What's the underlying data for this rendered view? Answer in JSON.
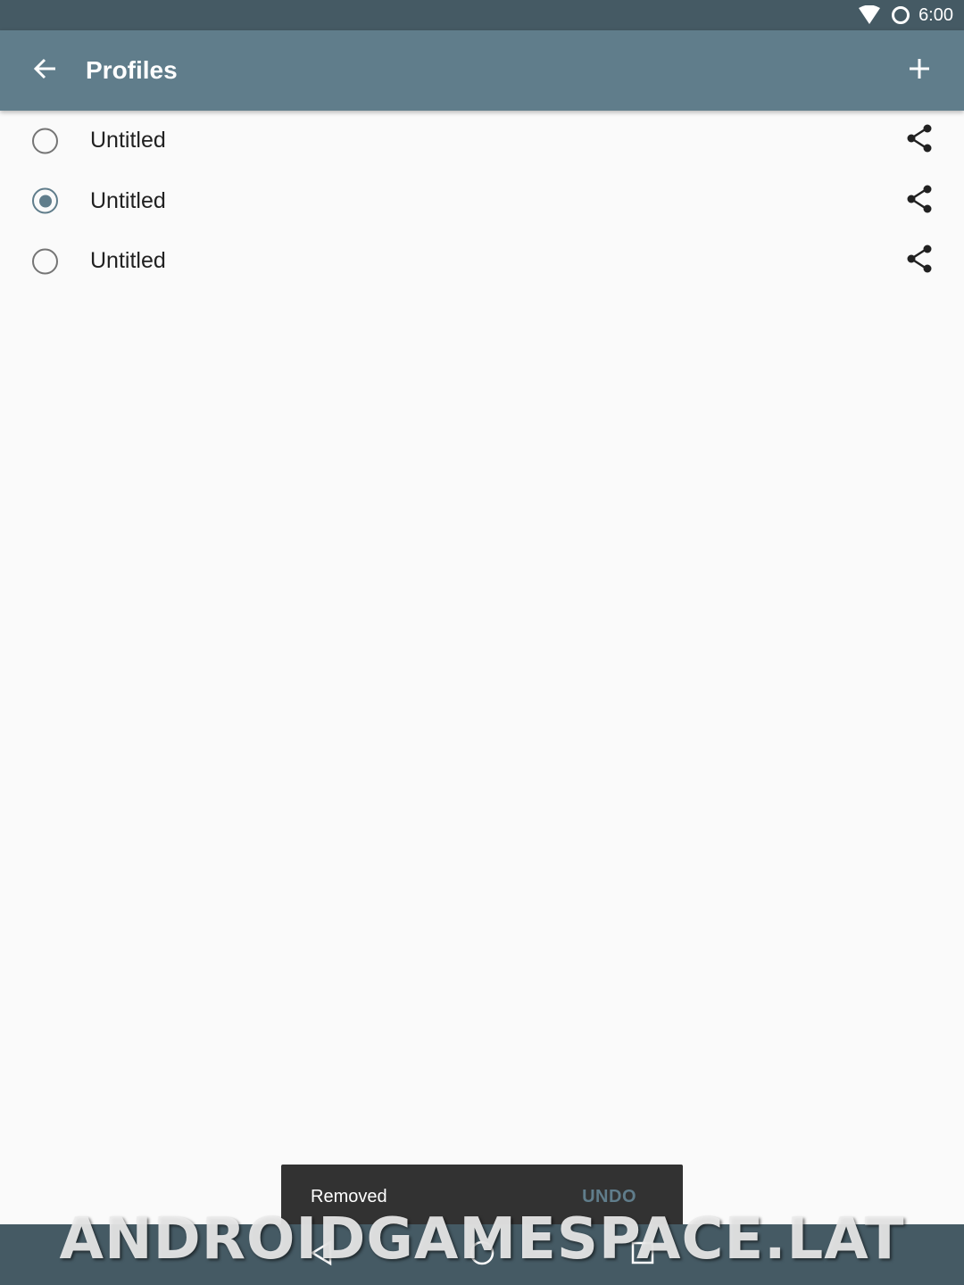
{
  "status_bar": {
    "time": "6:00",
    "icons": [
      "wifi-icon",
      "sync-icon"
    ]
  },
  "app_bar": {
    "title": "Profiles",
    "back_icon": "arrow-back-icon",
    "add_icon": "plus-icon"
  },
  "profiles": [
    {
      "name": "Untitled",
      "selected": false
    },
    {
      "name": "Untitled",
      "selected": true
    },
    {
      "name": "Untitled",
      "selected": false
    }
  ],
  "snackbar": {
    "message": "Removed",
    "action": "UNDO"
  },
  "nav_bar": {
    "icons": [
      "back-triangle-icon",
      "home-circle-icon",
      "recents-square-icon"
    ]
  },
  "watermark": {
    "text": "ANDROIDGAMESPACE.LAT"
  },
  "colors": {
    "status_bar": "#455a64",
    "app_bar": "#607d8b",
    "accent": "#607d8b",
    "background": "#fafafa",
    "snackbar": "#323232"
  }
}
